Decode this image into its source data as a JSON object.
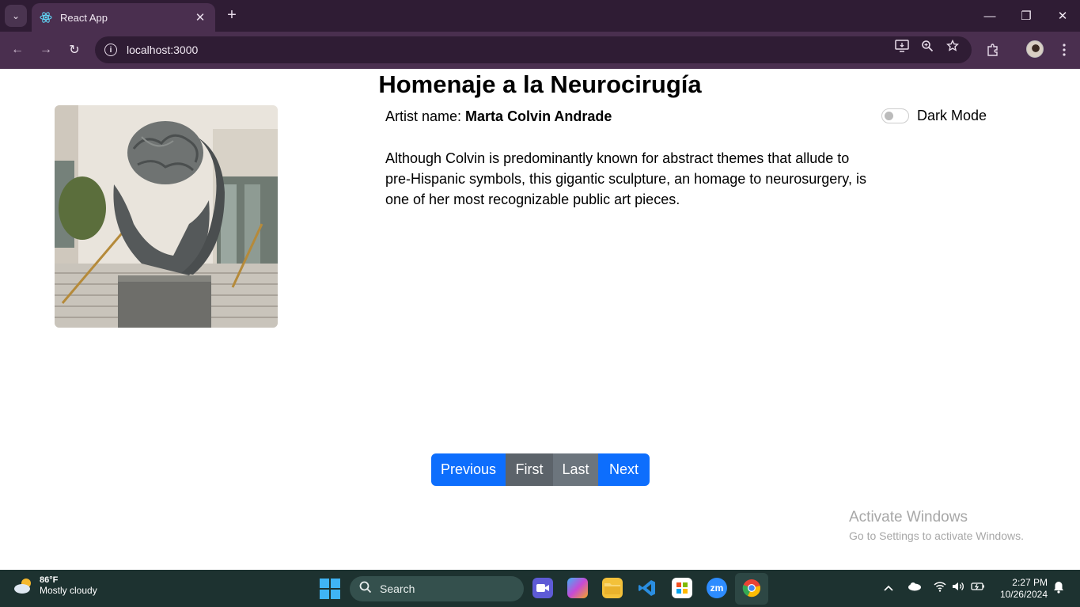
{
  "browser": {
    "tab_title": "React App",
    "tab_close": "✕",
    "new_tab": "+",
    "url": "localhost:3000",
    "info_glyph": "i",
    "back": "←",
    "forward": "→",
    "reload": "↻",
    "minimize": "—",
    "restore": "❐",
    "close": "✕",
    "tab_list": "⌄"
  },
  "artwork": {
    "title": "Homenaje a la Neurocirugía",
    "artist_label": "Artist name:",
    "artist_name": "Marta Colvin Andrade",
    "description": "Although Colvin is predominantly known for abstract themes that allude to pre-Hispanic symbols, this gigantic sculpture, an homage to neurosurgery, is one of her most recognizable public art pieces.",
    "image_icon": "sculpture-photo"
  },
  "dark_mode": {
    "label": "Dark Mode",
    "enabled": false
  },
  "pagination": {
    "previous": "Previous",
    "first": "First",
    "last": "Last",
    "next": "Next"
  },
  "watermark": {
    "line1": "Activate Windows",
    "line2": "Go to Settings to activate Windows."
  },
  "taskbar": {
    "temperature": "86°F",
    "condition": "Mostly cloudy",
    "search_label": "Search",
    "time": "2:27 PM",
    "date": "10/26/2024"
  },
  "colors": {
    "primary": "#0d6efd",
    "secondary": "#6c757d",
    "secondary_active": "#5c636a",
    "chrome_frame": "#2f1c34",
    "chrome_toolbar": "#4a2f4f",
    "taskbar": "#1d3230"
  }
}
